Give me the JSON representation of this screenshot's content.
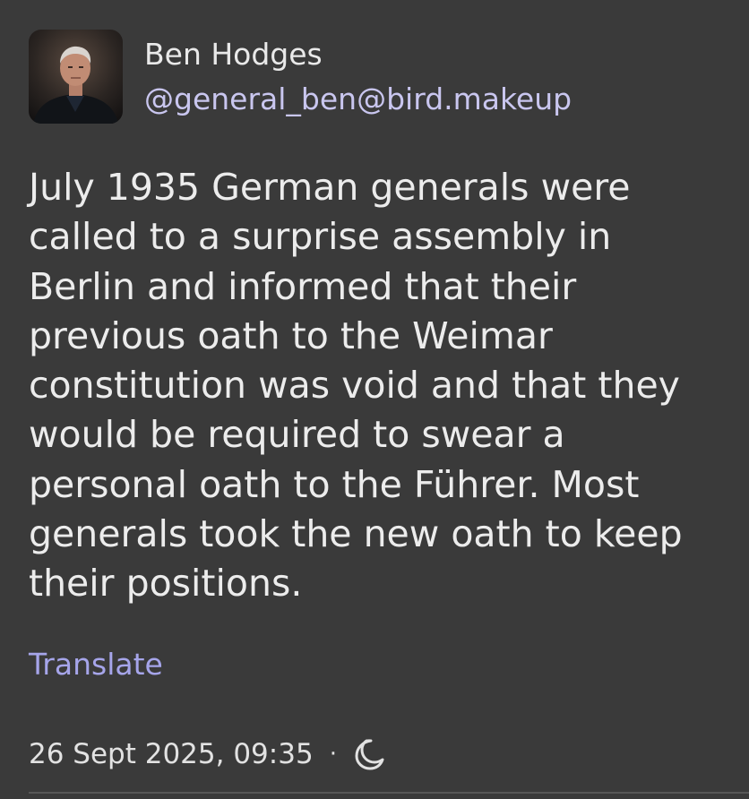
{
  "author": {
    "display_name": "Ben Hodges",
    "handle": "@general_ben@bird.makeup",
    "avatar_icon": "person-portrait-avatar"
  },
  "post": {
    "lines": [
      "July 1935 German generals were",
      "called to a surprise assembly in",
      "Berlin and informed that their",
      "previous oath to the Weimar",
      "constitution was void and that they",
      "would be required to swear a",
      "personal oath to the Führer. Most",
      "generals took the new oath to keep",
      "their positions."
    ]
  },
  "actions": {
    "translate_label": "Translate"
  },
  "meta": {
    "timestamp": "26 Sept 2025, 09:35",
    "separator": "·",
    "visibility_icon": "moon-icon"
  },
  "colors": {
    "background": "#3a3a3a",
    "text": "#ececec",
    "handle": "#c9c6ef",
    "link": "#a6a5ea"
  }
}
